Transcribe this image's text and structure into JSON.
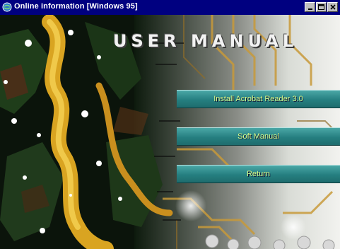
{
  "window": {
    "title": "Online information [Windows 95]",
    "controls": [
      "minimize-icon",
      "maximize-icon",
      "close-icon"
    ]
  },
  "heading": "USER MANUAL",
  "menu": [
    {
      "label": "Install Acrobat Reader 3.0"
    },
    {
      "label": "Soft Manual"
    },
    {
      "label": "Return"
    }
  ],
  "colors": {
    "titlebar": "#000080",
    "button": "#2f8a8b",
    "button_text": "#d8ff8c",
    "circuit": "#c89a3a"
  }
}
